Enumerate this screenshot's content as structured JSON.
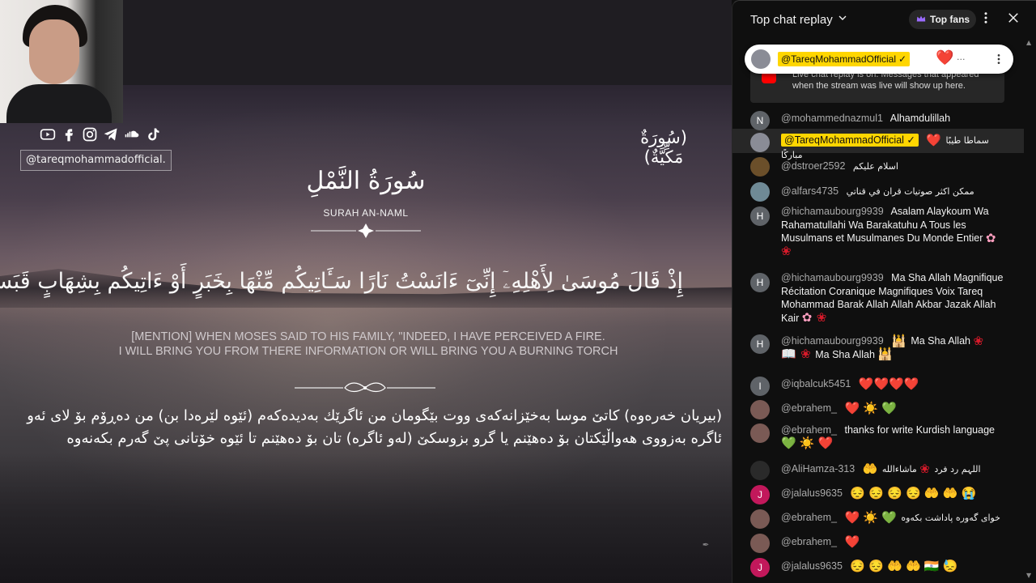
{
  "video": {
    "social_handle": "@tareqmohammadofficial.",
    "social_icons": [
      "youtube-icon",
      "facebook-icon",
      "instagram-icon",
      "telegram-icon",
      "soundcloud-icon",
      "tiktok-icon"
    ],
    "makki_label": "(سُورَةٌ مَكِّيَّةٌ)",
    "surah_arabic": "سُورَةُ النَّمْلِ",
    "surah_english": "SURAH AN-NAML",
    "ayah_arabic": "إِذْ قَالَ مُوسَىٰ لِأَهْلِهِۦٓ إِنِّىٓ ءَانَسْتُ نَارًا سَـَٔاتِيكُم مِّنْهَا بِخَبَرٍ أَوْ ءَاتِيكُم بِشِهَابٍ قَبَسٍ",
    "ayah_english_line1": "[MENTION] WHEN MOSES SAID TO HIS FAMILY, \"INDEED, I HAVE PERCEIVED A FIRE.",
    "ayah_english_line2": "I WILL BRING YOU FROM THERE INFORMATION OR WILL BRING YOU A BURNING TORCH",
    "kurdish_line1": "(بیریان خەرەوە) کاتێ موسا بەخێزانەکەی ووت بێگومان من ئاگرێك بەدیدەکەم (ئێوە لێرەدا بن) من دەڕۆم بۆ لای ئەو",
    "kurdish_line2": "ئاگرە بەزووی هەواڵێکتان بۆ دەهێنم یا گرو بزوسکێ (لەو ئاگرە) تان بۆ دەهێنم تا ئێوە خۆتانی پێ گەرم بکەنەوە"
  },
  "chat": {
    "title": "Top chat replay",
    "top_fans_label": "Top fans",
    "banner_text": "Live chat replay is on. Messages that appeared when the stream was live will show up here.",
    "pinned": {
      "author": "@TareqMohammadOfficial",
      "snippet": "...",
      "emoji": "❤️"
    },
    "messages": [
      {
        "avatar": "N",
        "avatar_color": "#5f6368",
        "author": "@mohammednazmul1",
        "text": "Alhamdulillah"
      },
      {
        "avatar": "",
        "avatar_color": "#8a8c96",
        "author": "@TareqMohammadOfficial",
        "owner": true,
        "emoji": "❤️",
        "text": "سماطا طيبًا مباركًا"
      },
      {
        "avatar": "",
        "avatar_color": "#6b4f2a",
        "author": "@dstroer2592",
        "text": "اسلام عليكم"
      },
      {
        "avatar": "",
        "avatar_color": "#6f8a96",
        "author": "@alfars4735",
        "text": "ممكن اكثر صوتيات قران في قناتي"
      },
      {
        "avatar": "H",
        "avatar_color": "#5f6368",
        "author": "@hichamaubourg9939",
        "text": "Asalam Alaykoum Wa Rahamatullahi Wa Barakatuhu A Tous les Musulmans et Musulmanes Du Monde Entier",
        "emoji_after": "🌸 🌹"
      },
      {
        "avatar": "H",
        "avatar_color": "#5f6368",
        "author": "@hichamaubourg9939",
        "text": "Ma Sha Allah Magnifique Récitation Coranique Magnifiques Voix Tareq Mohammad Barak Allah Allah Akbar Jazak Allah Kair",
        "emoji_after": "🌸 🌹"
      },
      {
        "avatar": "H",
        "avatar_color": "#5f6368",
        "author": "@hichamaubourg9939",
        "text_a": "Ma Sha Allah",
        "text_b": "Ma Sha Allah"
      },
      {
        "avatar": "I",
        "avatar_color": "#5f6368",
        "author": "@iqbalcuk5451",
        "emoji": "❤️❤️❤️❤️"
      },
      {
        "avatar": "",
        "avatar_color": "#7a5a55",
        "author": "@ebrahem_",
        "emoji": "❤️ ☀️ 💚"
      },
      {
        "avatar": "",
        "avatar_color": "#7a5a55",
        "author": "@ebrahem_",
        "text": "thanks for write Kurdish language",
        "emoji_after": "💚 ☀️ ❤️"
      },
      {
        "avatar": "",
        "avatar_color": "#2a2a2a",
        "author": "@AliHamza-313",
        "text": "اللہم رد فرد",
        "text2": "ماشاءالله"
      },
      {
        "avatar": "J",
        "avatar_color": "#c2185b",
        "author": "@jalalus9635"
      },
      {
        "avatar": "",
        "avatar_color": "#7a5a55",
        "author": "@ebrahem_",
        "text": "خوای گەورە پاداشت بکەوە"
      },
      {
        "avatar": "",
        "avatar_color": "#7a5a55",
        "author": "@ebrahem_"
      },
      {
        "avatar": "J",
        "avatar_color": "#c2185b",
        "author": "@jalalus9635"
      }
    ]
  },
  "colors": {
    "owner_badge": "#ffd600",
    "chat_bg": "#0f0f0f",
    "author_grey": "#aaaaaa",
    "heart_red": "#e3182d"
  }
}
